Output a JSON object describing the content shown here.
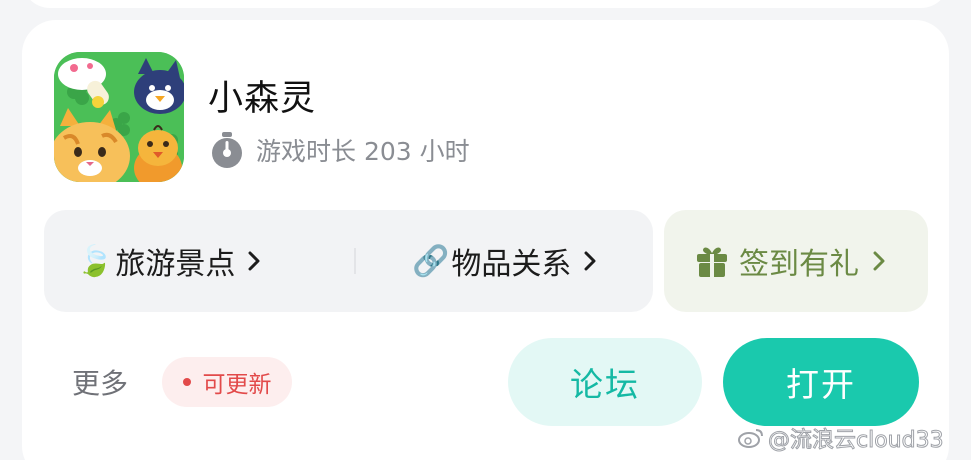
{
  "app": {
    "title": "小森灵",
    "playtime": "游戏时长 203 小时"
  },
  "shortcuts": [
    {
      "emoji": "🍃",
      "label": "旅游景点"
    },
    {
      "emoji": "🔗",
      "label": "物品关系"
    }
  ],
  "checkin": {
    "label": "签到有礼"
  },
  "footer": {
    "more_label": "更多",
    "update_badge": "可更新",
    "forum_button": "论坛",
    "open_button": "打开"
  },
  "watermark": {
    "text": "@流浪云cloud33"
  },
  "colors": {
    "accent": "#1ac9ad",
    "accent_light": "#e3f8f5",
    "update_red": "#e24a4a",
    "checkin_green": "#6b8a44"
  }
}
